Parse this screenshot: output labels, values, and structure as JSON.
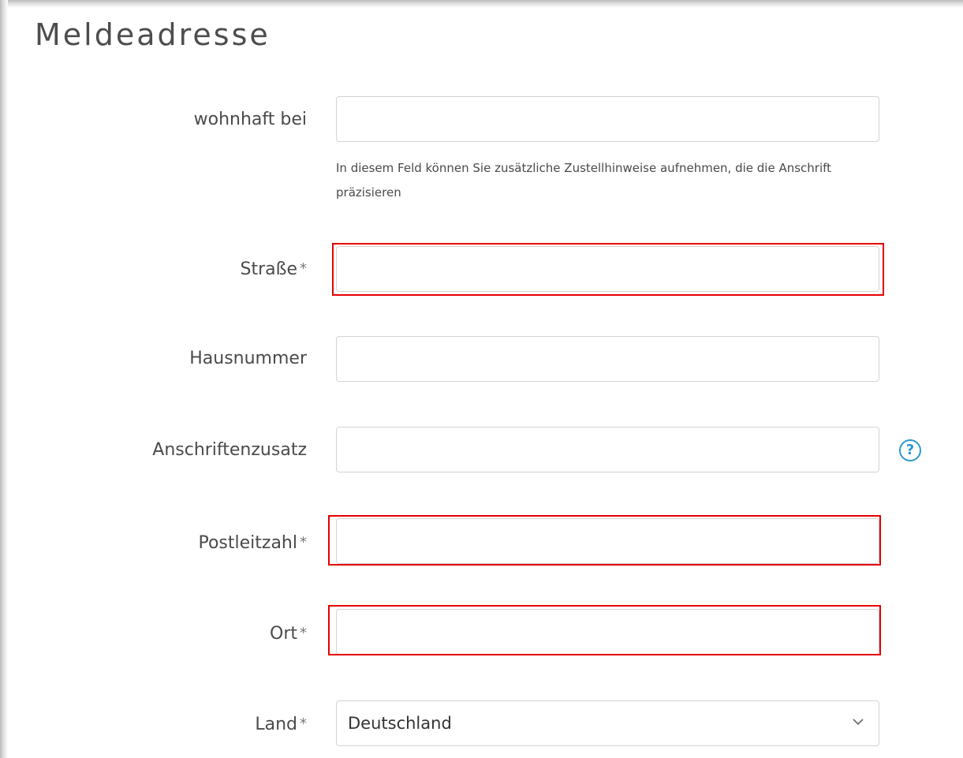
{
  "section": {
    "title": "Meldeadresse"
  },
  "fields": {
    "wohnhaft_bei": {
      "label": "wohnhaft bei",
      "value": "",
      "placeholder": ""
    },
    "hint": "In diesem Feld können Sie zusätzliche Zustellhinweise aufnehmen, die die Anschrift präzisieren",
    "strasse": {
      "label": "Straße",
      "required_mark": "*",
      "value": "",
      "placeholder": ""
    },
    "hausnummer": {
      "label": "Hausnummer",
      "value": "",
      "placeholder": ""
    },
    "anschriftenzusatz": {
      "label": "Anschriftenzusatz",
      "value": "",
      "placeholder": "",
      "help_icon": "question-circle-icon",
      "help_glyph": "?"
    },
    "postleitzahl": {
      "label": "Postleitzahl",
      "required_mark": "*",
      "value": "",
      "placeholder": ""
    },
    "ort": {
      "label": "Ort",
      "required_mark": "*",
      "value": "",
      "placeholder": ""
    },
    "land": {
      "label": "Land",
      "required_mark": "*",
      "selected": "Deutschland",
      "icon": "chevron-down-icon"
    }
  },
  "colors": {
    "highlight": "#e60000",
    "help_icon": "#2a9ad3",
    "input_border": "#d3d3d3"
  }
}
